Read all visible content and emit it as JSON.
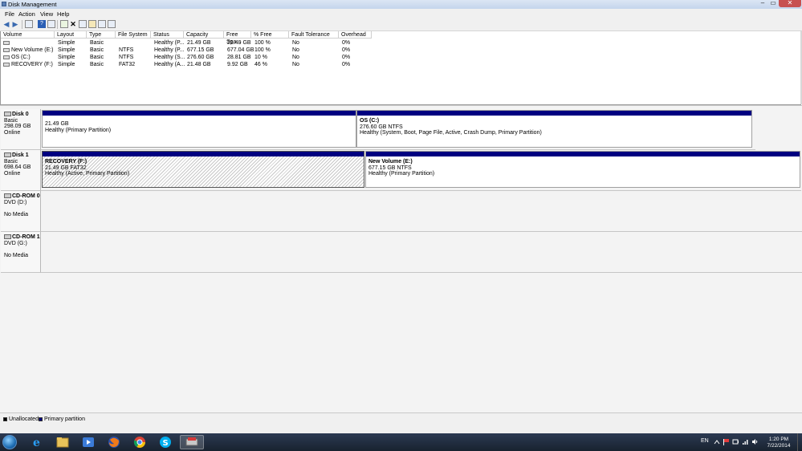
{
  "window": {
    "title": "Disk Management",
    "min_glyph": "–",
    "max_glyph": "▭",
    "close_glyph": "✕"
  },
  "menu": [
    "File",
    "Action",
    "View",
    "Help"
  ],
  "toolbar": {
    "back": "◀",
    "forward": "▶",
    "help": "?",
    "delete": "✕"
  },
  "volume_list": {
    "columns": [
      "Volume",
      "Layout",
      "Type",
      "File System",
      "Status",
      "Capacity",
      "Free Spa...",
      "% Free",
      "Fault Tolerance",
      "Overhead"
    ],
    "rows": [
      [
        "",
        "Simple",
        "Basic",
        "",
        "Healthy (P...",
        "21.49 GB",
        "21.49 GB",
        "100 %",
        "No",
        "0%"
      ],
      [
        "New Volume (E:)",
        "Simple",
        "Basic",
        "NTFS",
        "Healthy (P...",
        "677.15 GB",
        "677.04 GB",
        "100 %",
        "No",
        "0%"
      ],
      [
        "OS (C:)",
        "Simple",
        "Basic",
        "NTFS",
        "Healthy (S...",
        "276.60 GB",
        "28.81 GB",
        "10 %",
        "No",
        "0%"
      ],
      [
        "RECOVERY (F:)",
        "Simple",
        "Basic",
        "FAT32",
        "Healthy (A...",
        "21.48 GB",
        "9.92 GB",
        "46 %",
        "No",
        "0%"
      ]
    ]
  },
  "disks": [
    {
      "name": "Disk 0",
      "type": "Basic",
      "size": "298.09 GB",
      "state": "Online",
      "partitions": [
        {
          "title": "",
          "size": "21.49 GB",
          "status": "Healthy (Primary Partition)"
        },
        {
          "title": "OS  (C:)",
          "size": "276.60 GB NTFS",
          "status": "Healthy (System, Boot, Page File, Active, Crash Dump, Primary Partition)"
        }
      ]
    },
    {
      "name": "Disk 1",
      "type": "Basic",
      "size": "698.64 GB",
      "state": "Online",
      "partitions": [
        {
          "title": "RECOVERY  (F:)",
          "size": "21.49 GB FAT32",
          "status": "Healthy (Active, Primary Partition)"
        },
        {
          "title": "New Volume  (E:)",
          "size": "677.15 GB NTFS",
          "status": "Healthy (Primary Partition)"
        }
      ]
    },
    {
      "name": "CD-ROM 0",
      "type": "DVD (D:)",
      "state": "No Media"
    },
    {
      "name": "CD-ROM 1",
      "type": "DVD (G:)",
      "state": "No Media"
    }
  ],
  "legend": {
    "unallocated": "Unallocated",
    "primary": "Primary partition",
    "unallocated_color": "#000000",
    "primary_color": "#000080"
  },
  "taskbar": {
    "apps": [
      "internet-explorer-icon",
      "file-explorer-icon",
      "media-player-icon",
      "firefox-icon",
      "chrome-icon",
      "skype-icon",
      "disk-management-icon"
    ],
    "language": "EN",
    "time": "1:20 PM",
    "date": "7/22/2014"
  }
}
